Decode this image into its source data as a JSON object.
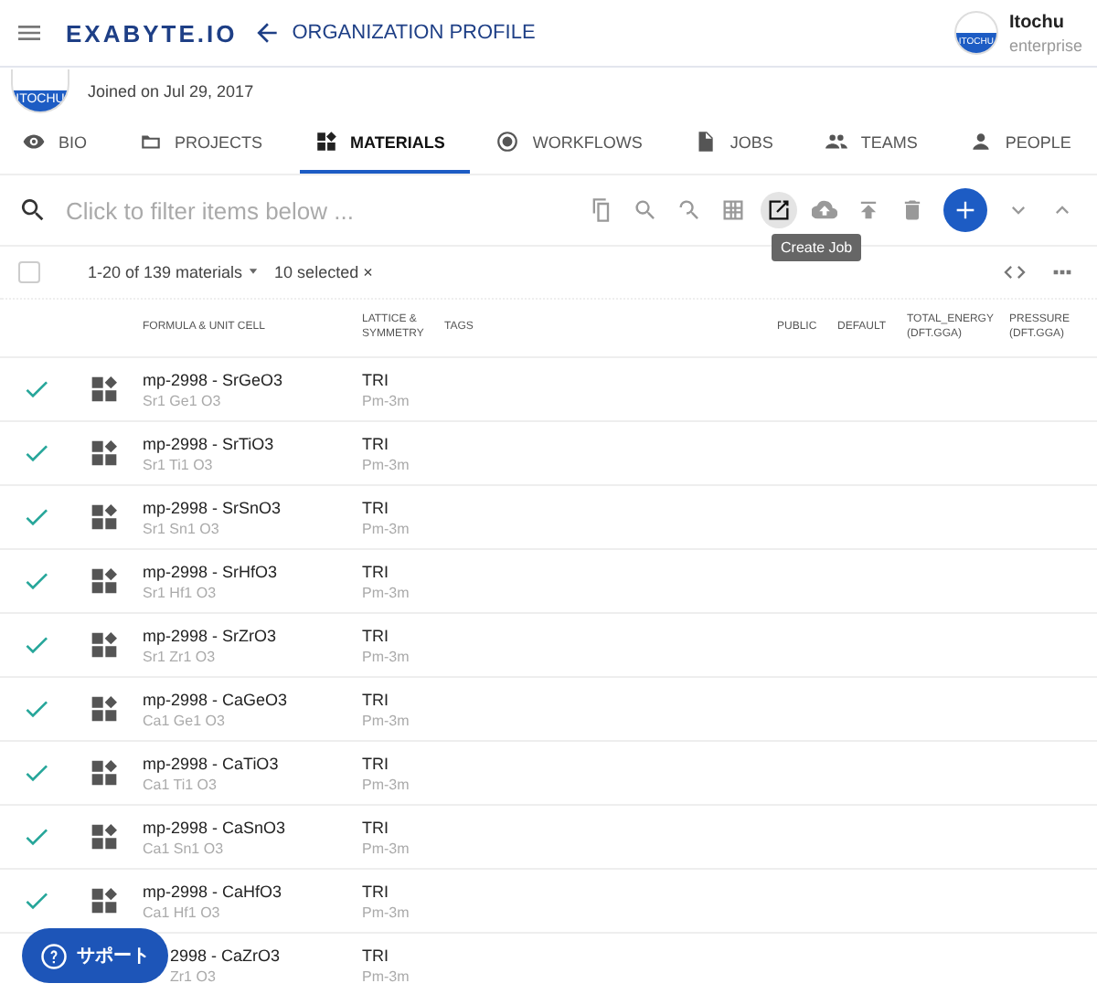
{
  "app_bar": {
    "logo": "EXABYTE.IO",
    "page_title": "ORGANIZATION PROFILE",
    "account": {
      "avatar_text": "ITOCHU",
      "name": "Itochu",
      "plan": "enterprise"
    }
  },
  "profile": {
    "avatar_text": "ITOCHU",
    "joined": "Joined on Jul 29, 2017"
  },
  "tabs": [
    {
      "label": "BIO",
      "selected": false
    },
    {
      "label": "PROJECTS",
      "selected": false
    },
    {
      "label": "MATERIALS",
      "selected": true
    },
    {
      "label": "WORKFLOWS",
      "selected": false
    },
    {
      "label": "JOBS",
      "selected": false
    },
    {
      "label": "TEAMS",
      "selected": false
    },
    {
      "label": "PEOPLE",
      "selected": false
    }
  ],
  "toolbar": {
    "placeholder": "Click to filter items below ...",
    "tooltip": "Create Job"
  },
  "summary": {
    "all_checked": false,
    "count": "1-20 of 139 materials",
    "selected": "10 selected ×"
  },
  "columns": [
    "FORMULA & UNIT CELL",
    "LATTICE & SYMMETRY",
    "TAGS",
    "PUBLIC",
    "DEFAULT",
    "TOTAL_ENERGY (DFT.GGA)",
    "PRESSURE (DFT.GGA)"
  ],
  "rows": [
    {
      "name": "mp-2998 - SrGeO3",
      "formula": "Sr1 Ge1 O3",
      "lattice": "TRI",
      "symmetry": "Pm-3m",
      "selected": true
    },
    {
      "name": "mp-2998 - SrTiO3",
      "formula": "Sr1 Ti1 O3",
      "lattice": "TRI",
      "symmetry": "Pm-3m",
      "selected": true
    },
    {
      "name": "mp-2998 - SrSnO3",
      "formula": "Sr1 Sn1 O3",
      "lattice": "TRI",
      "symmetry": "Pm-3m",
      "selected": true
    },
    {
      "name": "mp-2998 - SrHfO3",
      "formula": "Sr1 Hf1 O3",
      "lattice": "TRI",
      "symmetry": "Pm-3m",
      "selected": true
    },
    {
      "name": "mp-2998 - SrZrO3",
      "formula": "Sr1 Zr1 O3",
      "lattice": "TRI",
      "symmetry": "Pm-3m",
      "selected": true
    },
    {
      "name": "mp-2998 - CaGeO3",
      "formula": "Ca1 Ge1 O3",
      "lattice": "TRI",
      "symmetry": "Pm-3m",
      "selected": true
    },
    {
      "name": "mp-2998 - CaTiO3",
      "formula": "Ca1 Ti1 O3",
      "lattice": "TRI",
      "symmetry": "Pm-3m",
      "selected": true
    },
    {
      "name": "mp-2998 - CaSnO3",
      "formula": "Ca1 Sn1 O3",
      "lattice": "TRI",
      "symmetry": "Pm-3m",
      "selected": true
    },
    {
      "name": "mp-2998 - CaHfO3",
      "formula": "Ca1 Hf1 O3",
      "lattice": "TRI",
      "symmetry": "Pm-3m",
      "selected": true
    },
    {
      "name": "2998 - CaZrO3",
      "formula": "Zr1 O3",
      "lattice": "TRI",
      "symmetry": "Pm-3m"
    }
  ],
  "support_button": "サポート"
}
